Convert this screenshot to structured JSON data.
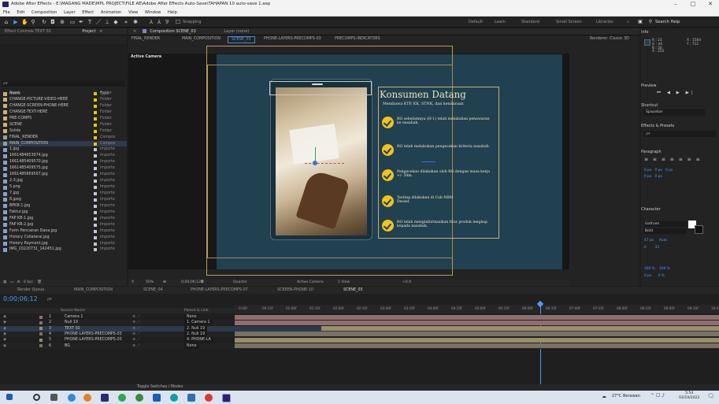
{
  "window": {
    "title": "Adobe After Effects - E:\\MAGANG MADE\\MPL PROJECT\\FILE AE\\Adobe After Effects Auto-Save\\TAHAPAN 10 auto-save 1.aep",
    "min": "–",
    "max": "□",
    "close": "✕"
  },
  "menu": [
    "File",
    "Edit",
    "Composition",
    "Layer",
    "Effect",
    "Animation",
    "View",
    "Window",
    "Help"
  ],
  "toolbar": {
    "snapping": "Snapping",
    "workspaces": [
      "Default",
      "Learn",
      "Standard",
      "Small Screen",
      "Libraries"
    ],
    "more": "»",
    "search": "Search Help"
  },
  "project": {
    "tabs": {
      "effect": "Effect Controls TEXT 02",
      "project": "Project"
    },
    "search_placeholder": "ρ▾",
    "col_name": "Name",
    "col_type": "Type",
    "items": [
      {
        "name": "Asset",
        "type": "Folder",
        "kind": "fld"
      },
      {
        "name": "CHANGE-PICTURE-VIDEO-HERE",
        "type": "Folder",
        "kind": "fld"
      },
      {
        "name": "CHANGE-SCREEN-PHONE-HERE",
        "type": "Folder",
        "kind": "fld"
      },
      {
        "name": "CHANGE-TEXT-HERE",
        "type": "Folder",
        "kind": "fld"
      },
      {
        "name": "PRE-COMPS",
        "type": "Folder",
        "kind": "fld"
      },
      {
        "name": "SCENE",
        "type": "Folder",
        "kind": "fld"
      },
      {
        "name": "Solids",
        "type": "Folder",
        "kind": "fld"
      },
      {
        "name": "FINAL_RENDER",
        "type": "Compos",
        "kind": "cmp"
      },
      {
        "name": "MAIN_COMPOSITION",
        "type": "Compos",
        "kind": "cmp"
      },
      {
        "name": "1.jpg",
        "type": "Importe",
        "kind": "img"
      },
      {
        "name": "1661484653974.jpg",
        "type": "Importe",
        "kind": "img"
      },
      {
        "name": "1661485409570.jpg",
        "type": "Importe",
        "kind": "img"
      },
      {
        "name": "1661485409575.jpg",
        "type": "Importe",
        "kind": "img"
      },
      {
        "name": "1661485669567.jpg",
        "type": "Importe",
        "kind": "img"
      },
      {
        "name": "2-3.jpg",
        "type": "Importe",
        "kind": "img"
      },
      {
        "name": "5.png",
        "type": "Importe",
        "kind": "img"
      },
      {
        "name": "7.jpg",
        "type": "Importe",
        "kind": "img"
      },
      {
        "name": "8.jpeg",
        "type": "Importe",
        "kind": "img"
      },
      {
        "name": "BPKB-1.jpg",
        "type": "Importe",
        "kind": "img"
      },
      {
        "name": "Faktur.jpg",
        "type": "Importe",
        "kind": "img"
      },
      {
        "name": "FAP KB-1.jpg",
        "type": "Importe",
        "kind": "img"
      },
      {
        "name": "FAP KB-2.jpg",
        "type": "Importe",
        "kind": "img"
      },
      {
        "name": "Form Pencairan Dana.jpg",
        "type": "Importe",
        "kind": "img"
      },
      {
        "name": "History Collateral.jpg",
        "type": "Importe",
        "kind": "img"
      },
      {
        "name": "History Payment.jpg",
        "type": "Importe",
        "kind": "img"
      },
      {
        "name": "IMG_20220731_142451.jpg",
        "type": "Importe",
        "kind": "img"
      }
    ],
    "bpc": "8 bpc"
  },
  "composition": {
    "tab": "Composition SCENE_03",
    "layer_tab": "Layer (none)",
    "breadcrumbs": [
      "FINAL_RENDER",
      "MAIN_COMPOSITION",
      "SCENE_03",
      "PHONE-LAYERS-PRECOMPS-03",
      "PRECOMPS-INDICATORS"
    ],
    "renderer": "Renderer: Classic 3D",
    "active_camera": "Active Camera",
    "heading": "Konsumen Datang",
    "subheading": "Membawa KTP, KK, STNK, dan kendaraan",
    "bullets": [
      "RO sebelumnya (H-1) telah melakukan penawaran ke nasabah.",
      "RO telah melakukan pengecekan kriteria nasabah.",
      "Pengecekan dilakukan oleh RO dengan masa kerja +/- 30m.",
      "Testing dilakukan di Cab NBM Desset",
      "RO telah menginformasikan fitur produk lengkap kepada nasabah."
    ],
    "footer": {
      "zoom": "50%",
      "time": "0;00;06;12",
      "quality": "Quarter",
      "camera": "Active Camera",
      "view": "1 View",
      "offset": "+0.0"
    }
  },
  "timeline": {
    "tabs": [
      "Render Queue",
      "MAIN_COMPOSITION",
      "SCENE_04",
      "PHONE-LAYERS-PRECOMPS-07",
      "SCREEN-PHONE-10",
      "SCENE_03"
    ],
    "timecode": "0;00;06;12",
    "col_source": "Source Name",
    "col_parent": "Parent & Link",
    "ruler": [
      "0:00f",
      "00:15f",
      "01:00f",
      "01:15f",
      "02:00f",
      "02:15f",
      "03:00f",
      "03:15f",
      "04:00f",
      "04:15f",
      "05:00f",
      "05:15f",
      "06:00f",
      "06:15f",
      "07:00f",
      "07:15f",
      "08:00f",
      "08:15f",
      "09:00f",
      "09:15f",
      "10:0"
    ],
    "layers": [
      {
        "num": "1",
        "name": "Camera 1",
        "parent": "None",
        "color": "#8e6f6f"
      },
      {
        "num": "2",
        "name": "Null 19",
        "parent": "1. Camera 1",
        "color": "#8e6f6f"
      },
      {
        "num": "3",
        "name": "TEXT 02",
        "parent": "2. Null 19",
        "color": "#9a8d6c"
      },
      {
        "num": "4",
        "name": "PHONE-LAYERS-PRECOMPS-03",
        "parent": "2. Null 19",
        "color": "#7a7363"
      },
      {
        "num": "5",
        "name": "PHONE-LAYERS-PRECOMPS-03",
        "parent": "4. PHONE-LA",
        "color": "#9a8d6c"
      },
      {
        "num": "6",
        "name": "BG",
        "parent": "None",
        "color": "#7a7363"
      }
    ],
    "toggle": "Toggle Switches / Modes"
  },
  "right": {
    "info": "Info",
    "rgb": [
      "R : 23",
      "G : 44",
      "B : 50",
      "A : 255"
    ],
    "xy": [
      "X : 1504",
      "Y : 712"
    ],
    "preview": "Preview",
    "shortcut": "Shortcut",
    "shortcut_val": "Spacebar",
    "effects": "Effects & Presets",
    "paragraph": "Paragraph",
    "para_vals": [
      "0 px",
      "0 px",
      "0 px",
      "0 px",
      "0 px"
    ],
    "character": "Character",
    "font": "Gotham",
    "style": "Bold",
    "char_vals": [
      "47 px",
      "Auto",
      "0",
      "35",
      "100 %",
      "100 %",
      "0 px",
      "0 %"
    ]
  },
  "taskbar": {
    "weather": "27°C Berawan",
    "time": "5:54",
    "date": "03/10/2022"
  }
}
